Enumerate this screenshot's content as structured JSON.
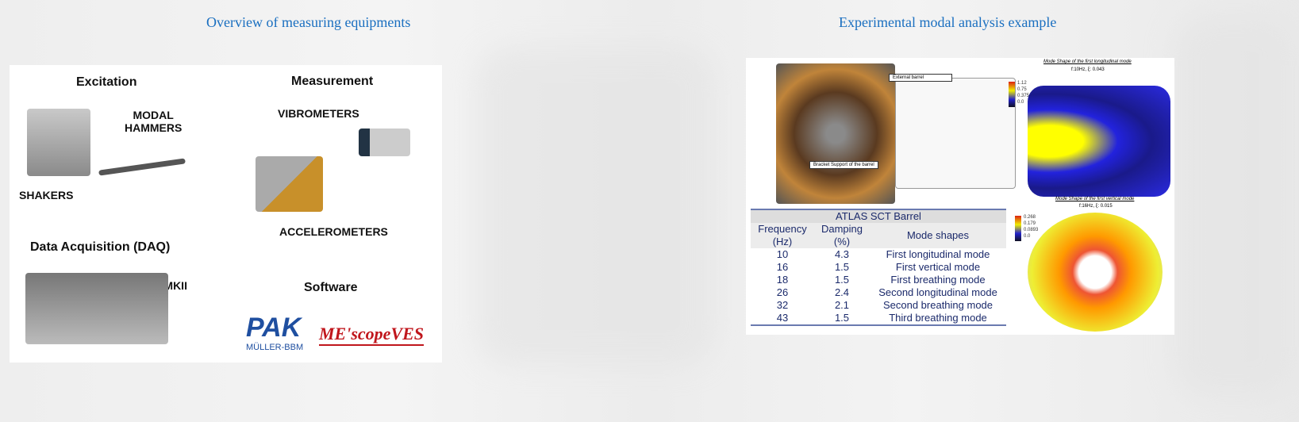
{
  "left": {
    "heading": "Overview of measuring equipments",
    "labels": {
      "excitation": "Excitation",
      "measurement": "Measurement",
      "modal_hammers": "MODAL\nHAMMERS",
      "shakers": "SHAKERS",
      "vibrometers": "VIBROMETERS",
      "accelerometers": "ACCELEROMETERS",
      "daq": "Data Acquisition (DAQ)",
      "pak": "PAK MKII",
      "software": "Software"
    },
    "logos": {
      "pak": "PAK",
      "muller": "MÜLLER-BBM",
      "mescope": "ME'scopeVES"
    }
  },
  "right": {
    "heading": "Experimental modal analysis example",
    "photo_labels": {
      "external": "External barrel",
      "bracket": "Bracket Support of the barrel"
    },
    "mode1": {
      "title": "Mode Shape of the first longitudinal mode",
      "sub": "f:10Hz, ξ: 0.043",
      "scale": [
        "1.12",
        "0.75",
        "0.375",
        "0.0"
      ]
    },
    "mode2": {
      "title": "Mode Shape of the first vertical mode",
      "sub": "f:16Hz, ξ: 0.015",
      "scale": [
        "0.268",
        "0.179",
        "0.0893",
        "0.0"
      ]
    },
    "table": {
      "title": "ATLAS SCT Barrel",
      "headers": [
        "Frequency (Hz)",
        "Damping (%)",
        "Mode shapes"
      ],
      "rows": [
        [
          "10",
          "4.3",
          "First longitudinal mode"
        ],
        [
          "16",
          "1.5",
          "First vertical mode"
        ],
        [
          "18",
          "1.5",
          "First breathing mode"
        ],
        [
          "26",
          "2.4",
          "Second longitudinal mode"
        ],
        [
          "32",
          "2.1",
          "Second breathing mode"
        ],
        [
          "43",
          "1.5",
          "Third breathing mode"
        ]
      ]
    }
  }
}
